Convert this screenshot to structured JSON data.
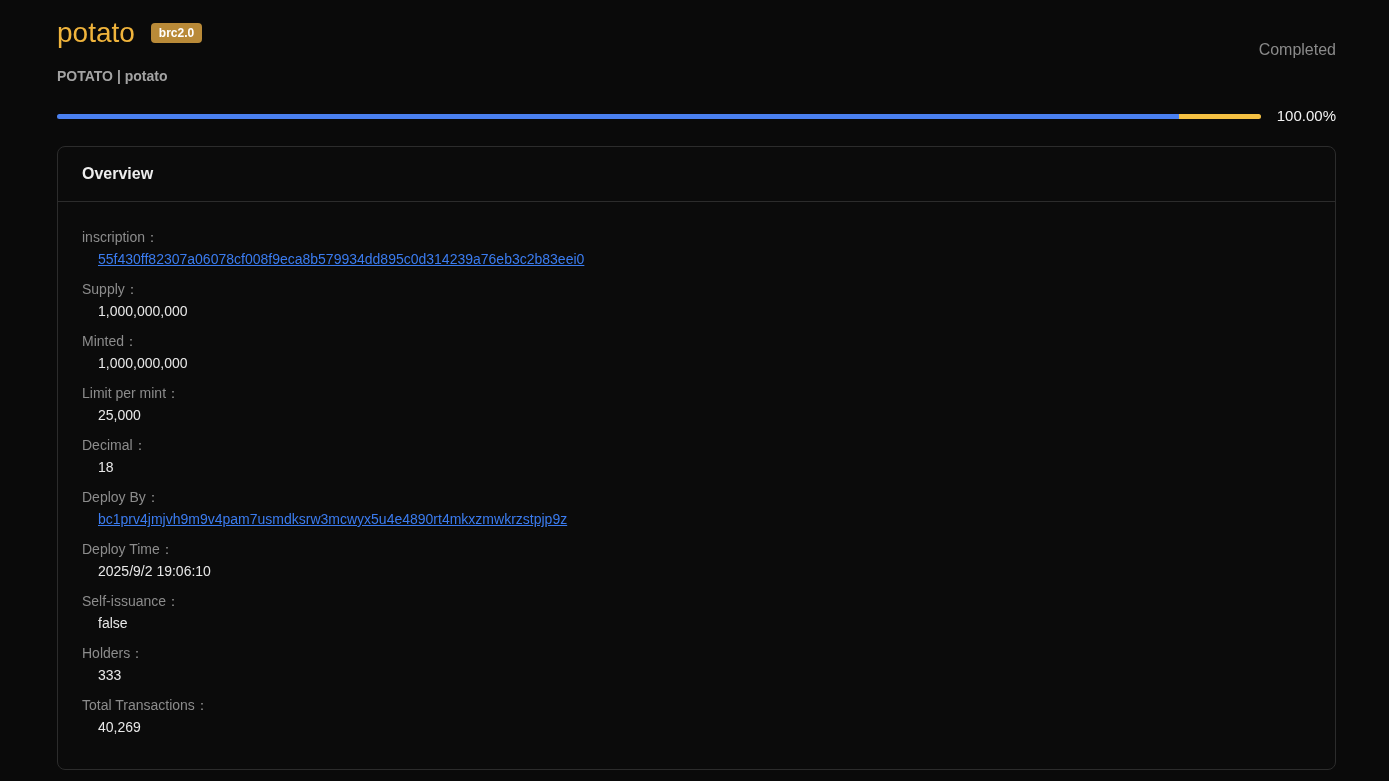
{
  "token": {
    "name": "potato",
    "badge": "brc2.0",
    "subtitle": "POTATO | potato",
    "status": "Completed"
  },
  "progress": {
    "segments": [
      {
        "level": 0.932,
        "color": "#4a80f0"
      },
      {
        "level": 0.068,
        "color": "#f5c142"
      }
    ],
    "reading": "100.00%"
  },
  "overview": {
    "title": "Overview",
    "fields": [
      {
        "label": "inscription：",
        "value": "55f430ff82307a06078cf008f9eca8b579934dd895c0d314239a76eb3c2b83eei0",
        "kind": "link"
      },
      {
        "label": "Supply：",
        "value": "1,000,000,000",
        "kind": "text"
      },
      {
        "label": "Minted：",
        "value": "1,000,000,000",
        "kind": "text"
      },
      {
        "label": "Limit per mint：",
        "value": "25,000",
        "kind": "text"
      },
      {
        "label": "Decimal：",
        "value": "18",
        "kind": "text"
      },
      {
        "label": "Deploy By：",
        "value": "bc1prv4jmjvh9m9v4pam7usmdksrw3mcwyx5u4e4890rt4mkxzmwkrzstpjp9z",
        "kind": "link"
      },
      {
        "label": "Deploy Time：",
        "value": "2025/9/2 19:06:10",
        "kind": "text"
      },
      {
        "label": "Self-issuance：",
        "value": "false",
        "kind": "text"
      },
      {
        "label": "Holders：",
        "value": "333",
        "kind": "text"
      },
      {
        "label": "Total Transactions：",
        "value": "40,269",
        "kind": "text"
      }
    ]
  }
}
